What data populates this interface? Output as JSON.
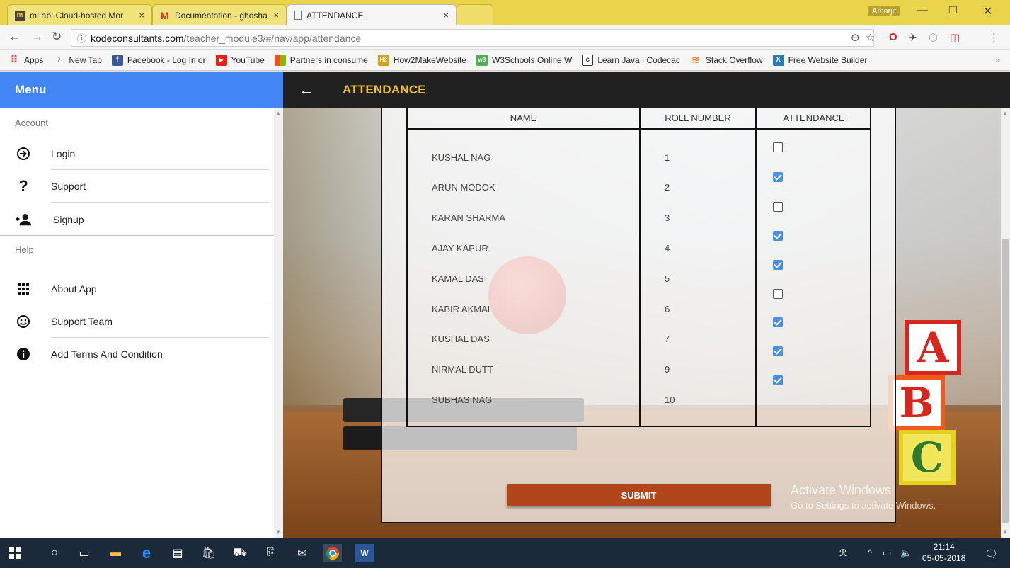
{
  "browser": {
    "tabs": [
      {
        "title": "mLab: Cloud-hosted Mor",
        "favicon": "mlab-icon"
      },
      {
        "title": "Documentation - ghosha",
        "favicon": "gmail-icon"
      },
      {
        "title": "ATTENDANCE",
        "favicon": "page-icon"
      }
    ],
    "profile_name": "Amarjit",
    "url_host": "kodeconsultants.com",
    "url_path": "/teacher_module3/#/nav/app/attendance",
    "bookmarks": [
      {
        "label": "Apps",
        "icon": "apps-grid-icon",
        "color": "#e04a3a"
      },
      {
        "label": "New Tab",
        "icon": "bookmark-icon",
        "color": "#444444"
      },
      {
        "label": "Facebook - Log In or",
        "icon": "facebook-icon",
        "color": "#3b5998"
      },
      {
        "label": "YouTube",
        "icon": "youtube-icon",
        "color": "#e62117"
      },
      {
        "label": "Partners in consume",
        "icon": "windows-icon",
        "color": "#7cbb00"
      },
      {
        "label": "How2MakeWebsite",
        "icon": "html-icon",
        "color": "#d4a017"
      },
      {
        "label": "W3Schools Online W",
        "icon": "w3schools-icon",
        "color": "#4caf50"
      },
      {
        "label": "Learn Java | Codecac",
        "icon": "codecademy-icon",
        "color": "#333333"
      },
      {
        "label": "Stack Overflow",
        "icon": "stackoverflow-icon",
        "color": "#f48024"
      },
      {
        "label": "Free Website Builder",
        "icon": "builder-icon",
        "color": "#2a7ab8"
      }
    ]
  },
  "sidebar": {
    "header": "Menu",
    "section_account": "Account",
    "section_help": "Help",
    "account_items": [
      {
        "label": "Login",
        "icon": "login-icon"
      },
      {
        "label": "Support",
        "icon": "help-icon"
      },
      {
        "label": "Signup",
        "icon": "add-person-icon"
      }
    ],
    "help_items": [
      {
        "label": "About App",
        "icon": "apps-icon"
      },
      {
        "label": "Support Team",
        "icon": "smiley-icon"
      },
      {
        "label": "Add Terms And Condition",
        "icon": "info-icon"
      }
    ]
  },
  "appbar": {
    "title": "ATTENDANCE"
  },
  "table": {
    "headers": [
      "NAME",
      "ROLL NUMBER",
      "ATTENDANCE"
    ],
    "rows": [
      {
        "name": "KUSHAL NAG",
        "roll": "1"
      },
      {
        "name": "ARUN MODOK",
        "roll": "2"
      },
      {
        "name": "KARAN SHARMA",
        "roll": "3"
      },
      {
        "name": "AJAY KAPUR",
        "roll": "4"
      },
      {
        "name": "KAMAL DAS",
        "roll": "5"
      },
      {
        "name": "KABIR AKMAL",
        "roll": "6"
      },
      {
        "name": "KUSHAL DAS",
        "roll": "7"
      },
      {
        "name": "NIRMAL DUTT",
        "roll": "9"
      },
      {
        "name": "SUBHAS NAG",
        "roll": "10"
      }
    ],
    "attendance_checks": [
      false,
      true,
      false,
      true,
      true,
      false,
      true,
      true,
      true
    ]
  },
  "submit_label": "SUBMIT",
  "watermark": {
    "line1": "Activate Windows",
    "line2": "Go to Settings to activate Windows."
  },
  "taskbar": {
    "time": "21:14",
    "date": "05-05-2018"
  },
  "colors": {
    "menu_header": "#4285f4",
    "appbar": "#212121",
    "title_accent": "#f5c518",
    "submit": "#b2461b",
    "checkbox_on": "#4a90e2"
  }
}
